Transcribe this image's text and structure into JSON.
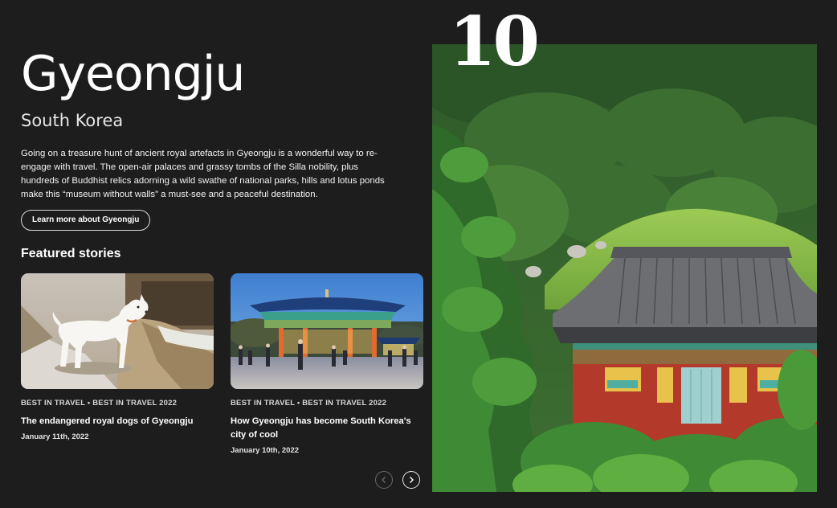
{
  "destination": {
    "name": "Gyeongju",
    "country": "South Korea",
    "rank": "10",
    "description": "Going on a treasure hunt of ancient royal artefacts in Gyeongju is a wonderful way to re-engage with travel. The open-air palaces and grassy tombs of the Silla nobility, plus hundreds of Buddhist relics adorning a wild swathe of national parks, hills and lotus ponds make this “museum without walls” a must-see and a peaceful destination.",
    "learn_more_label": "Learn more about Gyeongju"
  },
  "featured": {
    "heading": "Featured stories",
    "stories": [
      {
        "tag": "BEST IN TRAVEL • BEST IN TRAVEL 2022",
        "title": "The endangered royal dogs of Gyeongju",
        "date": "January 11th, 2022",
        "image_icon": "white-dog-photo"
      },
      {
        "tag": "BEST IN TRAVEL • BEST IN TRAVEL 2022",
        "title": "How Gyeongju has become South Korea's city of cool",
        "date": "January 10th, 2022",
        "image_icon": "pavilion-night-photo"
      }
    ]
  },
  "carousel": {
    "prev_icon": "chevron-left-icon",
    "next_icon": "chevron-right-icon"
  },
  "hero": {
    "image_icon": "temple-tomb-photo"
  },
  "colors": {
    "background": "#1d1d1d",
    "text": "#ffffff"
  }
}
